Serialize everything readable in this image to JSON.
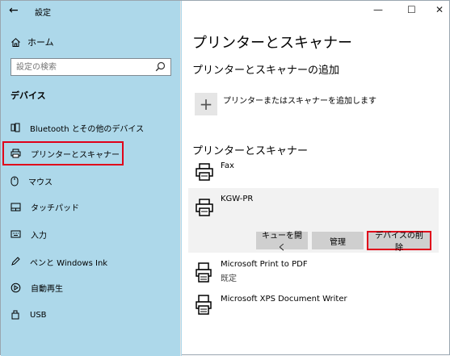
{
  "window": {
    "title": "設定",
    "controls": {
      "minimize": "—",
      "maximize": "☐",
      "close": "✕"
    }
  },
  "sidebar": {
    "home_label": "ホーム",
    "search_placeholder": "設定の検索",
    "section_label": "デバイス",
    "items": [
      {
        "label": "Bluetooth とその他のデバイス",
        "icon": "bluetooth-devices-icon"
      },
      {
        "label": "プリンターとスキャナー",
        "icon": "printer-icon",
        "selected": true
      },
      {
        "label": "マウス",
        "icon": "mouse-icon"
      },
      {
        "label": "タッチパッド",
        "icon": "touchpad-icon"
      },
      {
        "label": "入力",
        "icon": "keyboard-icon"
      },
      {
        "label": "ペンと Windows Ink",
        "icon": "pen-icon"
      },
      {
        "label": "自動再生",
        "icon": "autoplay-icon"
      },
      {
        "label": "USB",
        "icon": "usb-icon"
      }
    ]
  },
  "main": {
    "title": "プリンターとスキャナー",
    "add_section_title": "プリンターとスキャナーの追加",
    "add_label": "プリンターまたはスキャナーを追加します",
    "add_icon": "+",
    "list_title": "プリンターとスキャナー",
    "printers": [
      {
        "name": "Fax",
        "status": ""
      },
      {
        "name": "KGW-PR",
        "status": "",
        "selected": true
      },
      {
        "name": "Microsoft Print to PDF",
        "status": "既定"
      },
      {
        "name": "Microsoft XPS Document Writer",
        "status": ""
      }
    ],
    "buttons": {
      "open_queue": "キューを開く",
      "manage": "管理",
      "remove_device": "デバイスの削除"
    }
  },
  "colors": {
    "sidebar_bg": "#add8ea",
    "highlight_red": "#e0001a",
    "button_bg": "#cfcfcf",
    "selected_row_bg": "#f2f2f2"
  }
}
